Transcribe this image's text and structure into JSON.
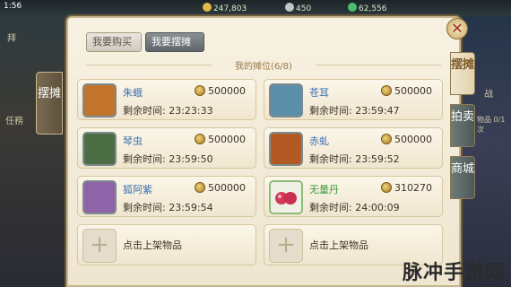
{
  "topbar": {
    "time": "1:56",
    "res1": "247,803",
    "res2": "450",
    "res3": "62,556"
  },
  "left_side": {
    "booth_tab": "摆摊",
    "top_text": "拜",
    "mid_text": "任務"
  },
  "tabs": {
    "buy": "我要购买",
    "sell": "我要摆摊"
  },
  "booth": {
    "title": "我的摊位(6/8)",
    "slots": [
      {
        "name": "朱蛾",
        "name_color": "#3a6fb0",
        "price": "500000",
        "remain_label": "剩余时间:",
        "remain": "23:23:33",
        "avatar_color": "#c2742c"
      },
      {
        "name": "苍耳",
        "name_color": "#3a6fb0",
        "price": "500000",
        "remain_label": "剩余时间:",
        "remain": "23:59:47",
        "avatar_color": "#5b8fa8"
      },
      {
        "name": "琴虫",
        "name_color": "#3a6fb0",
        "price": "500000",
        "remain_label": "剩余时间:",
        "remain": "23:59:50",
        "avatar_color": "#4d6d45"
      },
      {
        "name": "赤虬",
        "name_color": "#3a6fb0",
        "price": "500000",
        "remain_label": "剩余时间:",
        "remain": "23:59:52",
        "avatar_color": "#b35a24"
      },
      {
        "name": "狐阿紫",
        "name_color": "#3a6fb0",
        "price": "500000",
        "remain_label": "剩余时间:",
        "remain": "23:59:54",
        "avatar_color": "#8f63a8"
      },
      {
        "name": "无量丹",
        "name_color": "#3d9a3d",
        "price": "310270",
        "remain_label": "剩余时间:",
        "remain": "24:00:09",
        "avatar_color": "#c74a6a"
      }
    ],
    "empty_slots": [
      {
        "label": "点击上架物品"
      },
      {
        "label": "点击上架物品"
      }
    ]
  },
  "right_tabs": [
    "摆摊",
    "拍卖",
    "商城"
  ],
  "right_side": {
    "t1": "物品 0/1次",
    "t2": "战"
  },
  "watermark": "脉冲手游网"
}
